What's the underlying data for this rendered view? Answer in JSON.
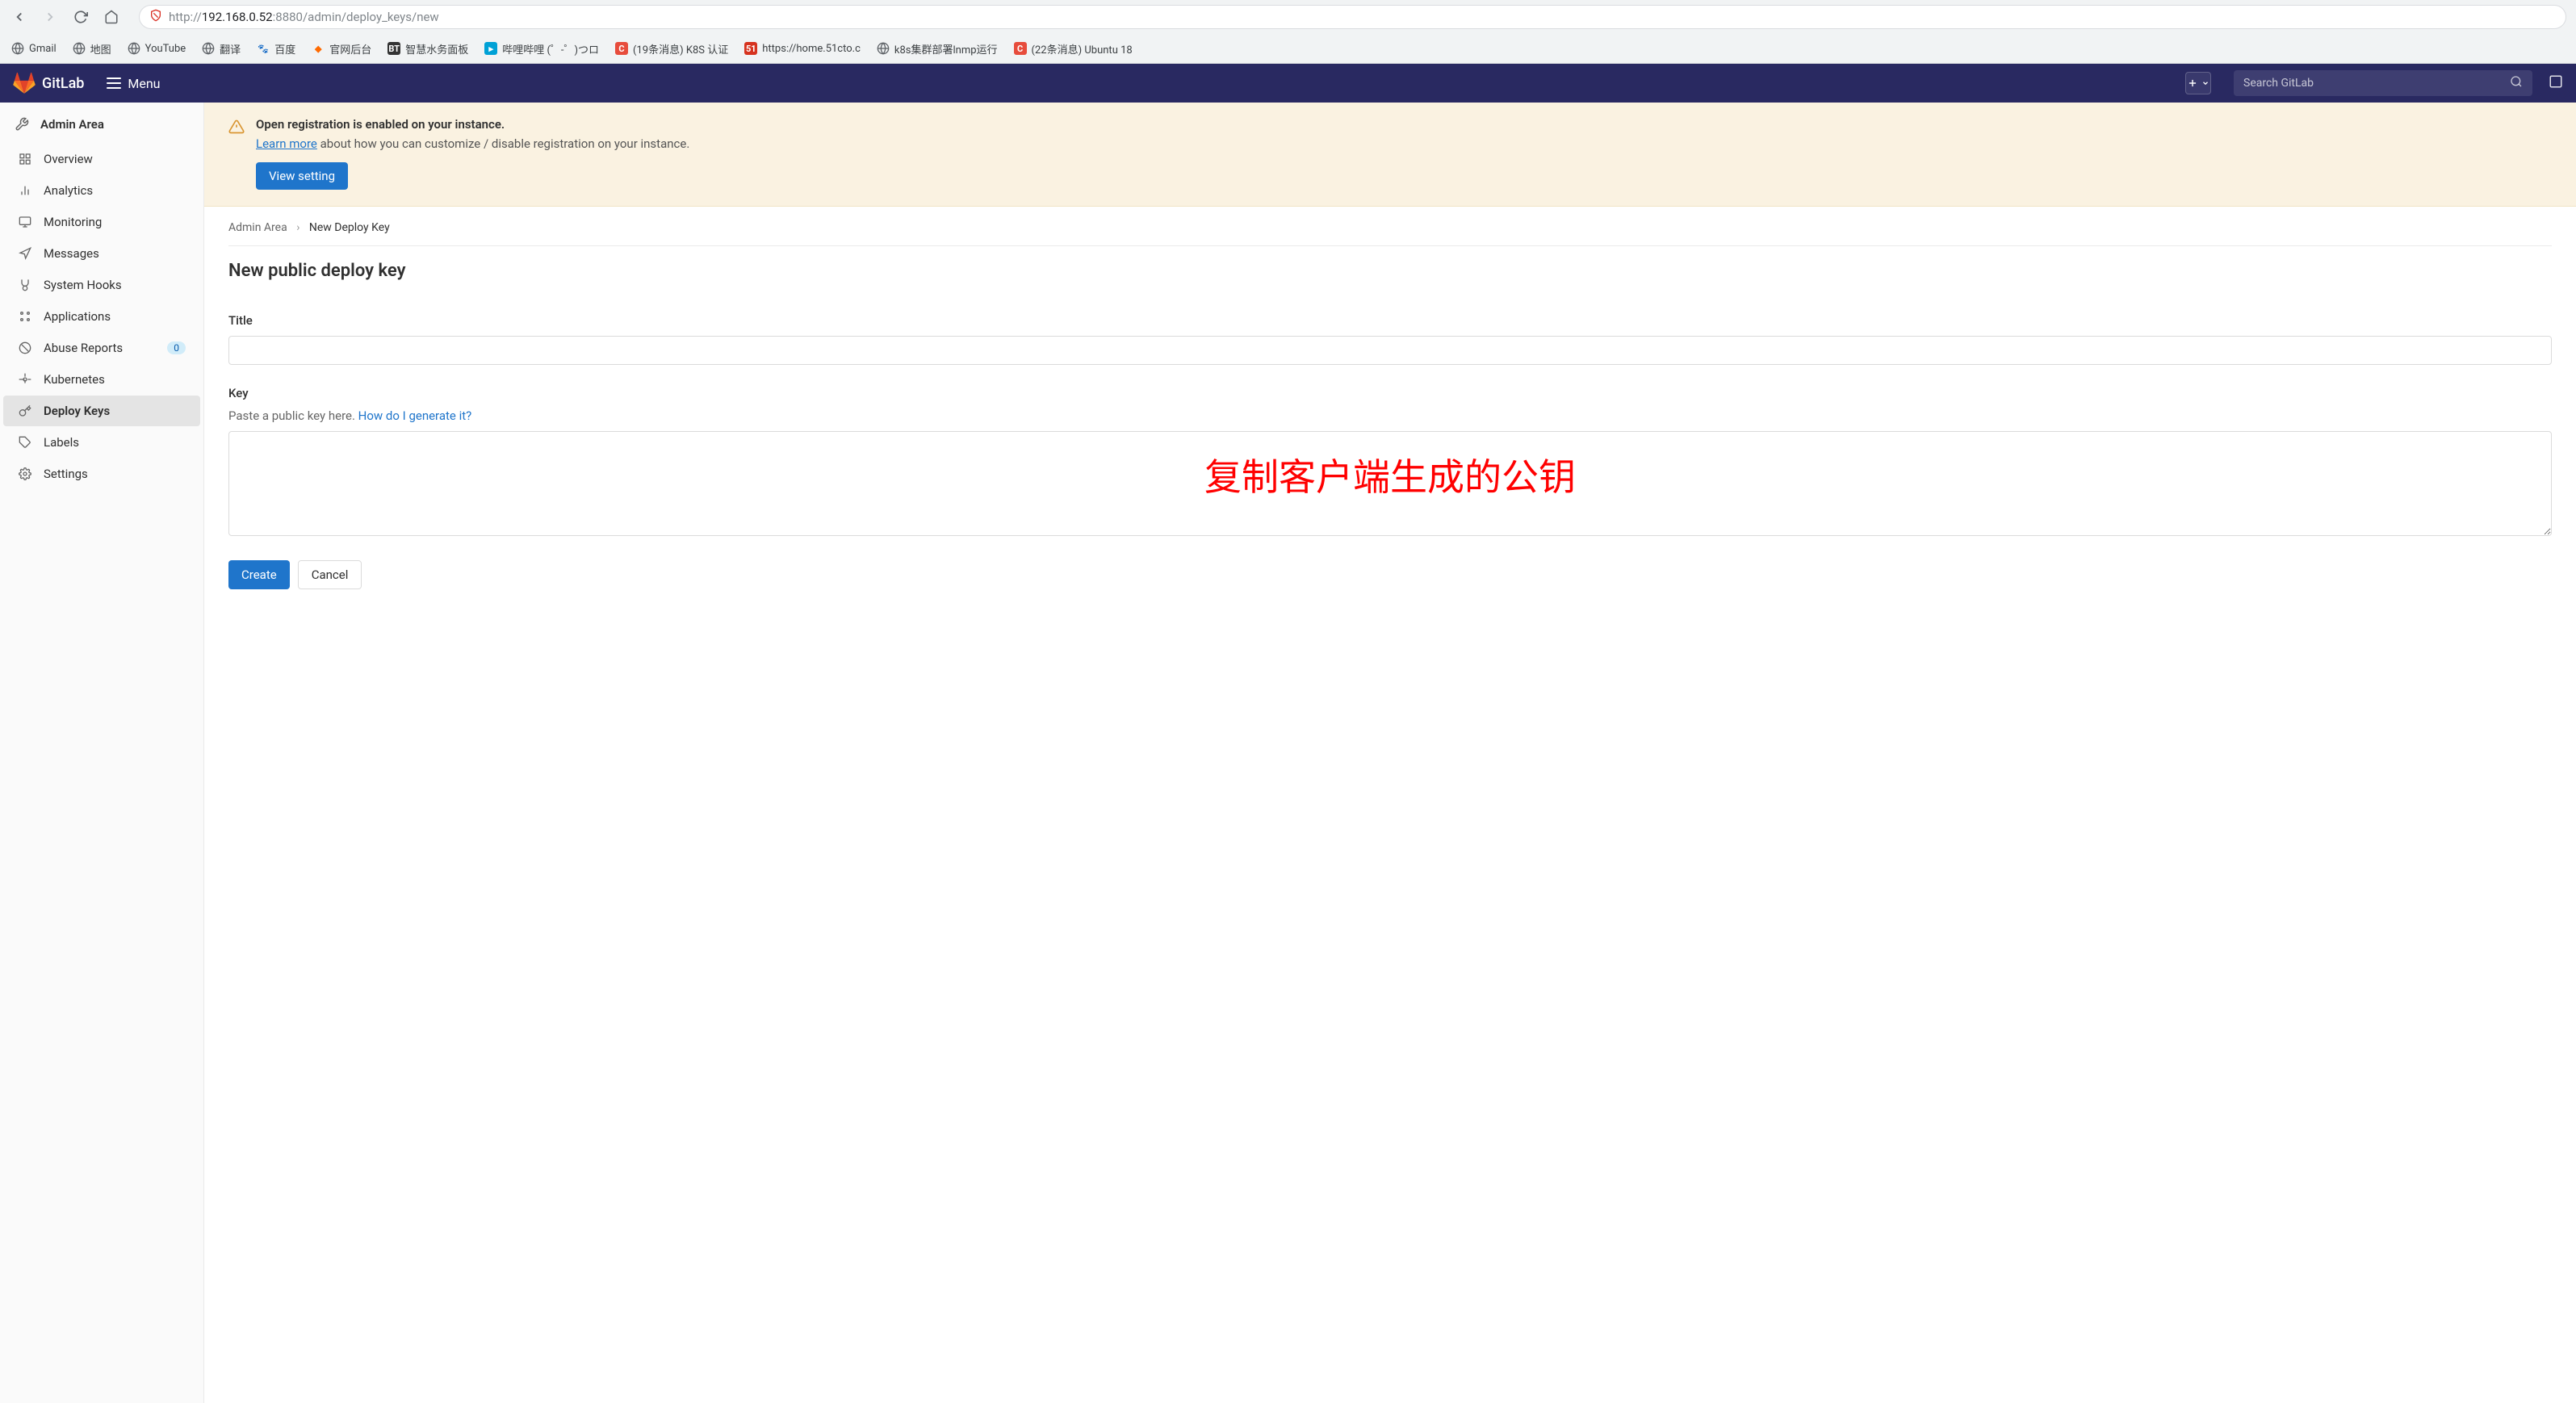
{
  "browser": {
    "url_prefix": "http://",
    "url_host": "192.168.0.52",
    "url_rest": ":8880/admin/deploy_keys/new",
    "bookmarks": [
      {
        "label": "Gmail",
        "icon": "globe"
      },
      {
        "label": "地图",
        "icon": "globe"
      },
      {
        "label": "YouTube",
        "icon": "globe"
      },
      {
        "label": "翻译",
        "icon": "globe"
      },
      {
        "label": "百度",
        "icon": "baidu"
      },
      {
        "label": "官网后台",
        "icon": "aliyun"
      },
      {
        "label": "智慧水务面板",
        "icon": "bt"
      },
      {
        "label": "哔哩哔哩 (゜-゜)つロ",
        "icon": "bili"
      },
      {
        "label": "(19条消息) K8S 认证",
        "icon": "c"
      },
      {
        "label": "https://home.51cto.c",
        "icon": "c51"
      },
      {
        "label": "k8s集群部署lnmp运行",
        "icon": "globe"
      },
      {
        "label": "(22条消息) Ubuntu 18",
        "icon": "c"
      }
    ]
  },
  "header": {
    "brand": "GitLab",
    "menu": "Menu",
    "search_placeholder": "Search GitLab"
  },
  "sidebar": {
    "title": "Admin Area",
    "items": [
      {
        "label": "Overview",
        "icon": "overview"
      },
      {
        "label": "Analytics",
        "icon": "analytics"
      },
      {
        "label": "Monitoring",
        "icon": "monitoring"
      },
      {
        "label": "Messages",
        "icon": "messages"
      },
      {
        "label": "System Hooks",
        "icon": "hooks"
      },
      {
        "label": "Applications",
        "icon": "apps"
      },
      {
        "label": "Abuse Reports",
        "icon": "abuse",
        "badge": "0"
      },
      {
        "label": "Kubernetes",
        "icon": "kubernetes"
      },
      {
        "label": "Deploy Keys",
        "icon": "keys",
        "active": true
      },
      {
        "label": "Labels",
        "icon": "labels"
      },
      {
        "label": "Settings",
        "icon": "settings"
      }
    ]
  },
  "alert": {
    "title": "Open registration is enabled on your instance.",
    "learn_more": "Learn more",
    "text_rest": " about how you can customize / disable registration on your instance.",
    "button": "View setting"
  },
  "breadcrumbs": {
    "root": "Admin Area",
    "current": "New Deploy Key"
  },
  "page": {
    "heading": "New public deploy key",
    "title_label": "Title",
    "key_label": "Key",
    "key_help_prefix": "Paste a public key here. ",
    "key_help_link": "How do I generate it?",
    "create": "Create",
    "cancel": "Cancel"
  },
  "annotation": {
    "text": "复制客户端生成的公钥"
  }
}
